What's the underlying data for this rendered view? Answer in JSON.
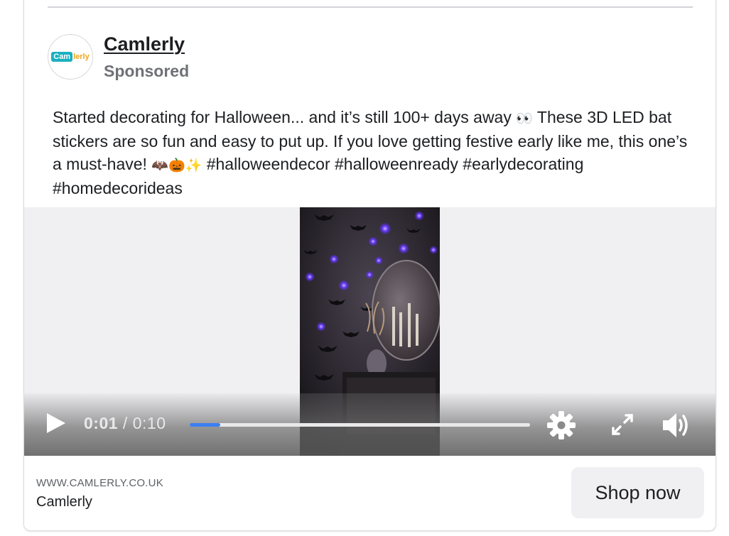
{
  "post": {
    "advertiser": "Camlerly",
    "sponsored_label": "Sponsored",
    "logo": {
      "part1": "Cam",
      "part2": "lerly"
    },
    "caption": {
      "text1": "Started decorating for Halloween... and it’s still 100+ days away ",
      "emoji1": "👀",
      "text2": " These 3D LED bat stickers are so fun and easy to put up. If you love getting festive early like me, this one’s a must-have! ",
      "emoji2": "🦇🎃✨",
      "text3": " #halloweendecor #halloweenready #earlydecorating #homedecorideas"
    }
  },
  "video": {
    "current_time": "0:01",
    "separator": " / ",
    "duration": "0:10",
    "progress": 0.09,
    "icons": {
      "play": "play-icon",
      "settings": "gear-icon",
      "fullscreen": "fullscreen-icon",
      "volume": "volume-icon"
    }
  },
  "footer": {
    "domain": "WWW.CAMLERLY.CO.UK",
    "brand": "Camlerly",
    "cta_label": "Shop now"
  },
  "colors": {
    "progress": "#3c7ff0",
    "cta_background": "#f0eff2",
    "bat_glow": "#6a3cff"
  }
}
